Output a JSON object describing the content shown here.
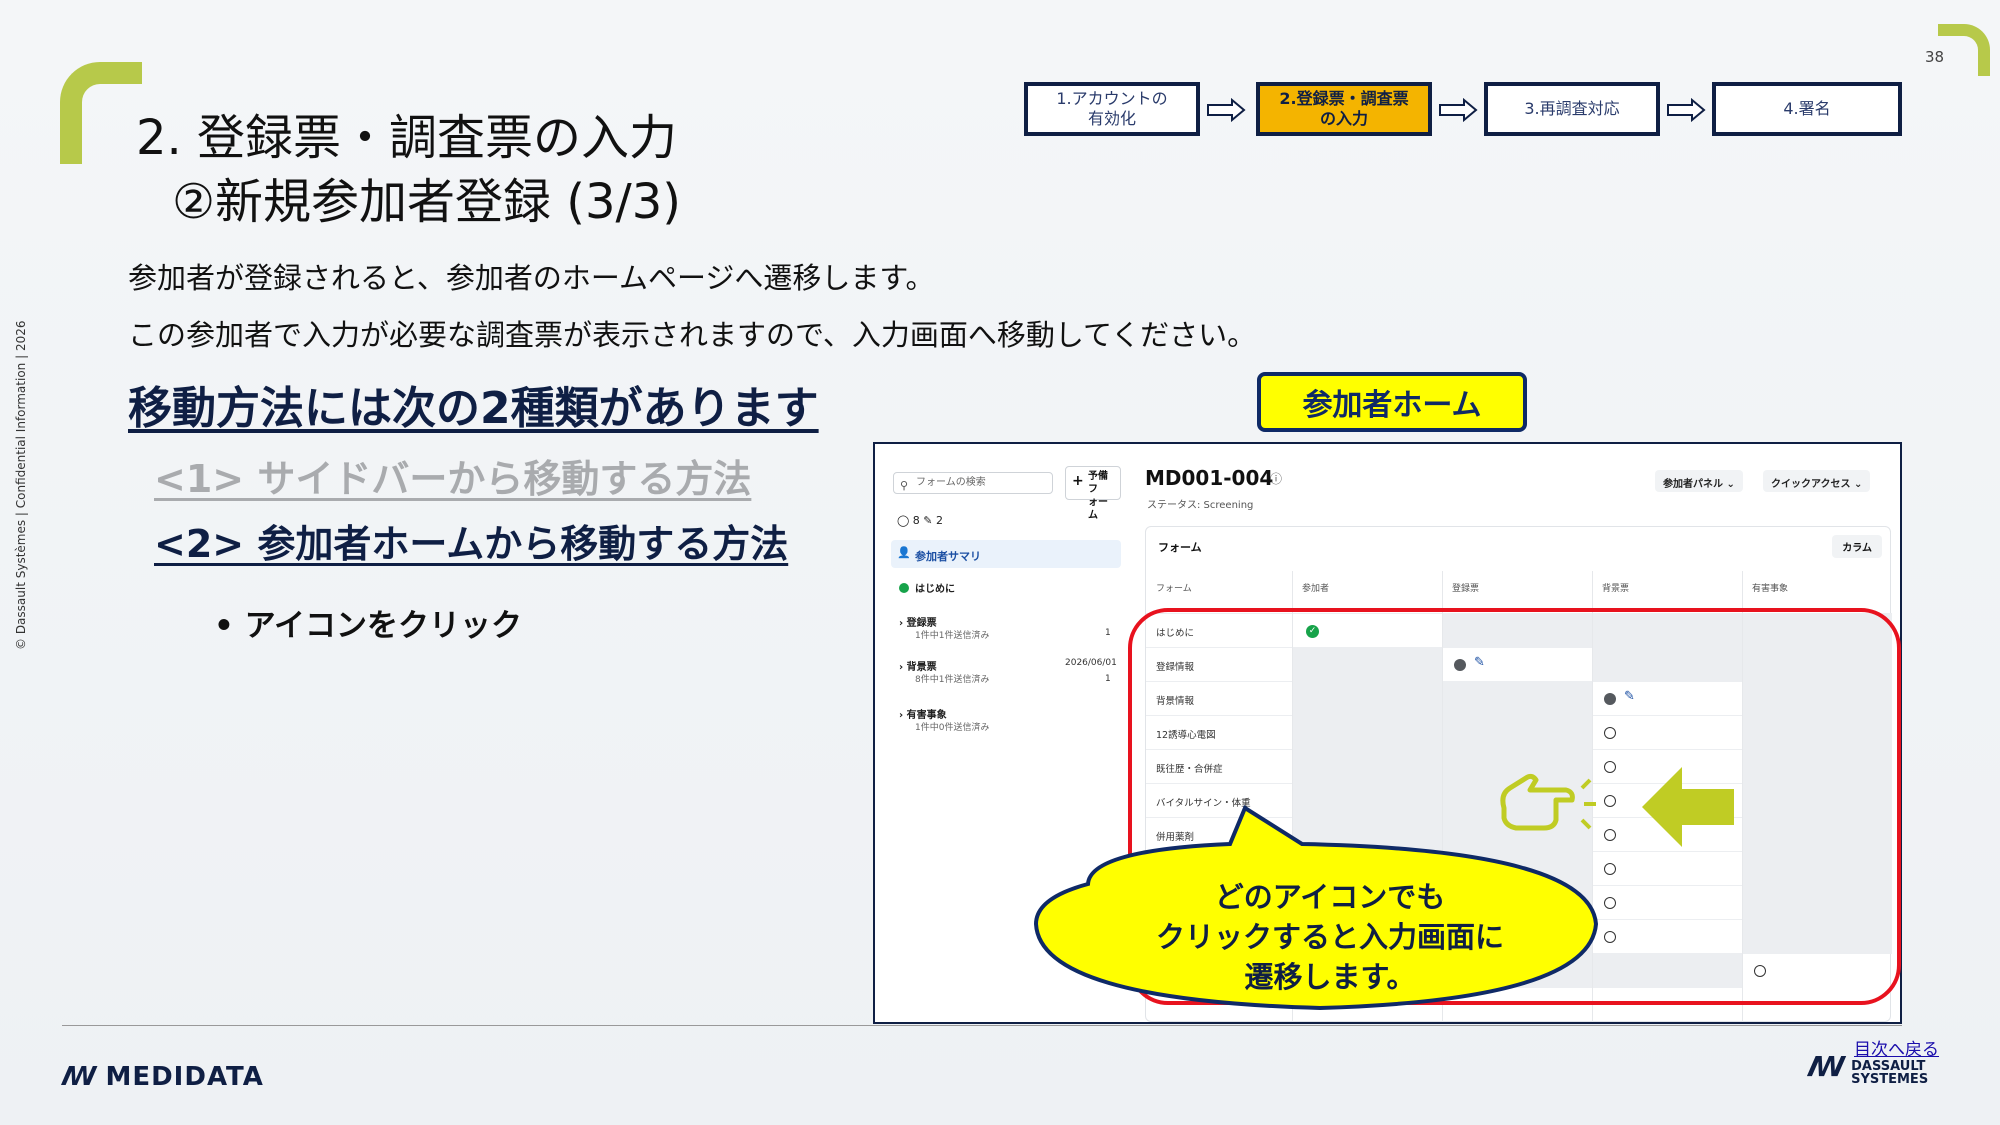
{
  "page": {
    "number": "38",
    "side_note": "© Dassault Systèmes | Confidential Information | 2026",
    "title_line1": "2. 登録票・調査票の入力",
    "title_line2": "②新規参加者登録 (3/3)"
  },
  "steps": [
    {
      "label": "1.アカウントの\n有効化"
    },
    {
      "label": "2.登録票・調査票\nの入力"
    },
    {
      "label": "3.再調査対応"
    },
    {
      "label": "4.署名"
    }
  ],
  "body": {
    "line1": "参加者が登録されると、参加者のホームページへ遷移します。",
    "line2": "この参加者で入力が必要な調査票が表示されますので、入力画面へ移動してください。",
    "methods_heading": "移動方法には次の2種類があります",
    "method1": "<1> サイドバーから移動する方法",
    "method2": "<2> 参加者ホームから移動する方法",
    "bullet": "• アイコンをクリック"
  },
  "home_label": "参加者ホーム",
  "app": {
    "search_placeholder": "フォームの検索",
    "pred_form": "予備フ\nォーム",
    "counts": "◯ 8    ✎ 2",
    "nav_summary": "参加者サマリ",
    "sidebar": [
      {
        "label": "はじめに"
      },
      {
        "label": "登録票",
        "sub": "1件中1件送信済み",
        "count": "1"
      },
      {
        "label": "背景票",
        "sub": "8件中1件送信済み",
        "date": "2026/06/01",
        "count": "1"
      },
      {
        "label": "有害事象",
        "sub": "1件中0件送信済み"
      }
    ],
    "subject_id": "MD001-004",
    "status": "ステータス: Screening",
    "btn_panel": "参加者パネル ⌄",
    "btn_quick": "クイックアクセス ⌄",
    "panel_title": "フォーム",
    "column_btn": "カラム",
    "headers": [
      "フォーム",
      "参加者",
      "登録票",
      "背景票",
      "有害事象"
    ],
    "rows": [
      {
        "label": "はじめに"
      },
      {
        "label": "登録情報"
      },
      {
        "label": "背景情報"
      },
      {
        "label": "12誘導心電図"
      },
      {
        "label": "既往歴・合併症"
      },
      {
        "label": "バイタルサイン・体重"
      },
      {
        "label": "併用薬剤"
      },
      {
        "label": ""
      },
      {
        "label": ""
      },
      {
        "label": ""
      },
      {
        "label": ""
      }
    ]
  },
  "callout": "どのアイコンでも\nクリックすると入力画面に\n遷移します。",
  "footer": {
    "toc_link": "目次へ戻る",
    "medidata": "MEDIDATA",
    "dassault": "DASSAULT\nSYSTEMES"
  },
  "colors": {
    "accent_green": "#b7c94a",
    "navy": "#0f1f44",
    "active_step": "#f4b400",
    "highlight_yellow": "#ffff00",
    "red": "#e8121e"
  }
}
